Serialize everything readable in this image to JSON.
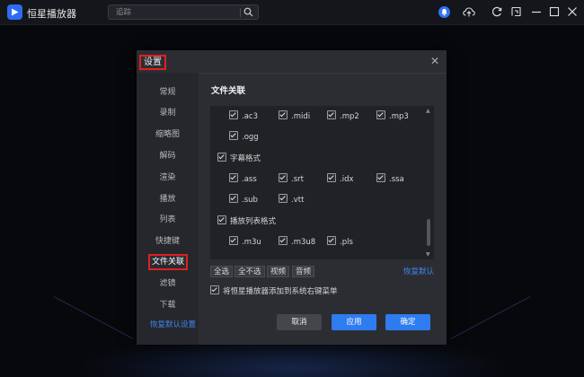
{
  "app": {
    "title": "恒星播放器"
  },
  "search": {
    "placeholder": "追踪"
  },
  "dialog": {
    "title": "设置",
    "sidebar": [
      "常规",
      "录制",
      "缩略图",
      "解码",
      "渲染",
      "播放",
      "列表",
      "快捷键",
      "文件关联",
      "滤镜",
      "下载"
    ],
    "active_item": "文件关联",
    "section_title": "文件关联",
    "audio_row1": [
      ".ac3",
      ".midi",
      ".mp2",
      ".mp3"
    ],
    "audio_row2": [
      ".ogg"
    ],
    "subtitle_group": "字幕格式",
    "subtitle_row1": [
      ".ass",
      ".srt",
      ".idx",
      ".ssa"
    ],
    "subtitle_row2": [
      ".sub",
      ".vtt"
    ],
    "playlist_group": "播放列表格式",
    "playlist_row1": [
      ".m3u",
      ".m3u8",
      ".pls"
    ],
    "select_buttons": [
      "全选",
      "全不选",
      "视频",
      "音频"
    ],
    "restore_default": "恢复默认",
    "context_menu_label": "将恒星播放器添加到系统右键菜单",
    "restore_defaults_link": "恢复默认设置",
    "cancel": "取消",
    "apply": "应用",
    "ok": "确定"
  },
  "colors": {
    "accent": "#2f7bf0",
    "highlight_border": "#e02020"
  }
}
